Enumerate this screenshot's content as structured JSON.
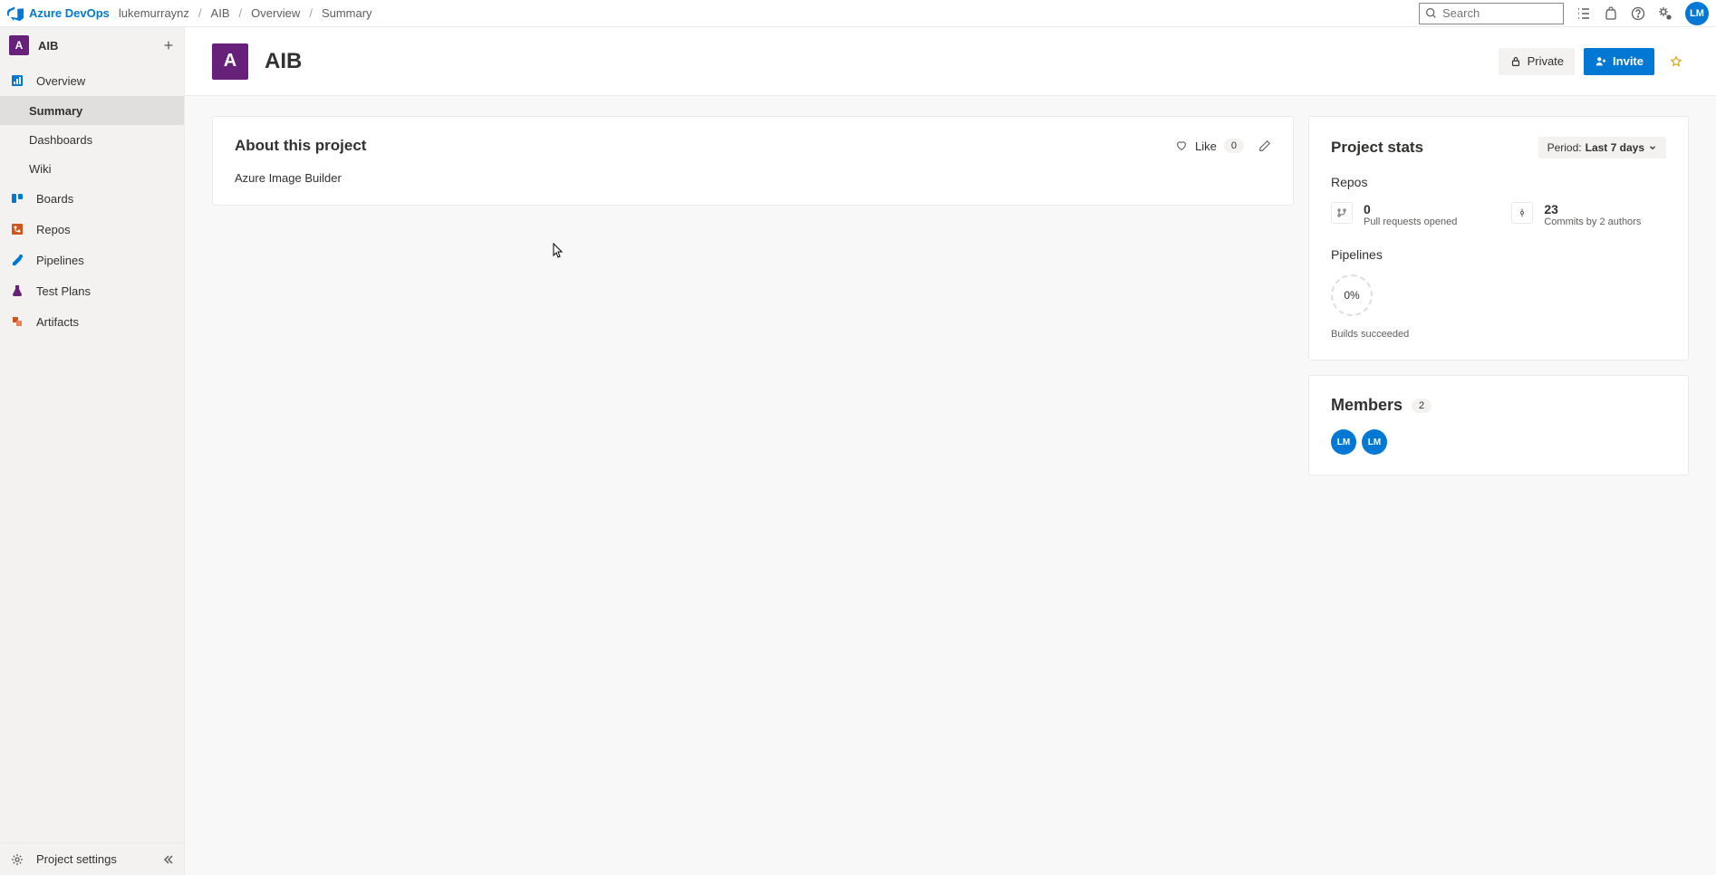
{
  "brand": "Azure DevOps",
  "breadcrumb": {
    "org": "lukemurraynz",
    "project": "AIB",
    "section": "Overview",
    "page": "Summary"
  },
  "search": {
    "placeholder": "Search"
  },
  "user": {
    "initials": "LM"
  },
  "sidebar": {
    "project": {
      "badge": "A",
      "name": "AIB"
    },
    "items": [
      {
        "label": "Overview"
      },
      {
        "label": "Summary"
      },
      {
        "label": "Dashboards"
      },
      {
        "label": "Wiki"
      },
      {
        "label": "Boards"
      },
      {
        "label": "Repos"
      },
      {
        "label": "Pipelines"
      },
      {
        "label": "Test Plans"
      },
      {
        "label": "Artifacts"
      }
    ],
    "footer": "Project settings"
  },
  "page": {
    "badge": "A",
    "title": "AIB",
    "privateLabel": "Private",
    "inviteLabel": "Invite"
  },
  "about": {
    "title": "About this project",
    "likeLabel": "Like",
    "likeCount": "0",
    "body": "Azure Image Builder"
  },
  "stats": {
    "title": "Project stats",
    "periodLabel": "Period:",
    "periodValue": "Last 7 days",
    "repos": {
      "label": "Repos",
      "pr": {
        "value": "0",
        "desc": "Pull requests opened"
      },
      "commits": {
        "value": "23",
        "desc": "Commits by 2 authors"
      }
    },
    "pipelines": {
      "label": "Pipelines",
      "percent": "0%",
      "desc": "Builds succeeded"
    }
  },
  "members": {
    "title": "Members",
    "count": "2",
    "list": [
      {
        "initials": "LM"
      },
      {
        "initials": "LM"
      }
    ]
  }
}
